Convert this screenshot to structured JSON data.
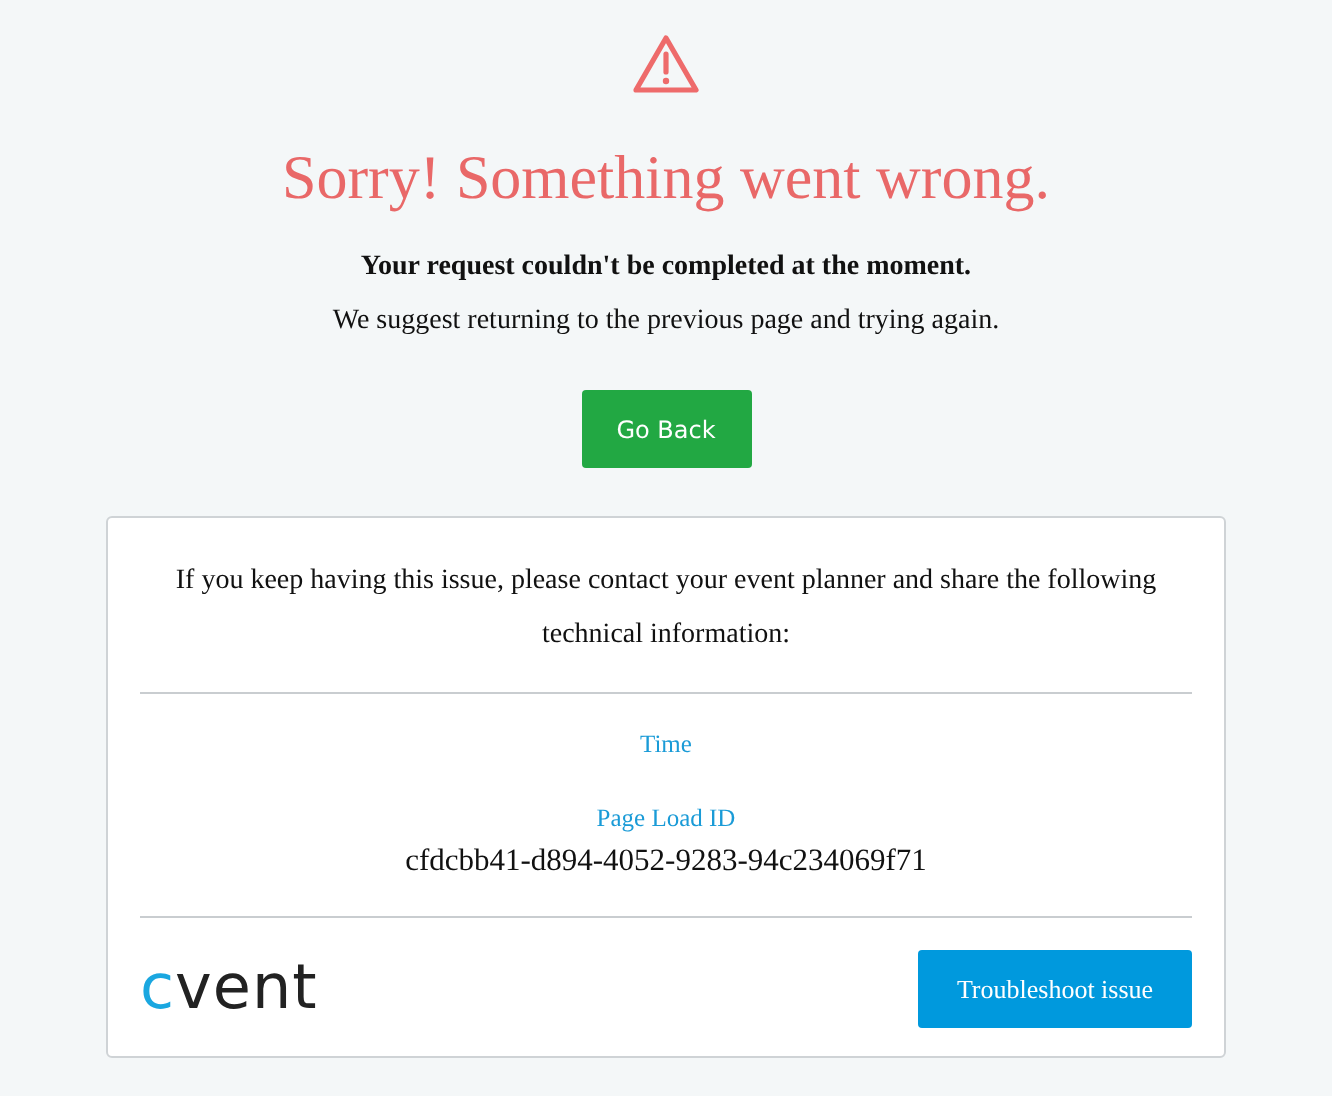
{
  "heading": "Sorry! Something went wrong.",
  "message_bold": "Your request couldn't be completed at the moment.",
  "message": "We suggest returning to the previous page and trying again.",
  "back_button": "Go Back",
  "card": {
    "intro": "If you keep having this issue, please contact your event planner and share the following technical information:",
    "fields": [
      {
        "label": "Time"
      },
      {
        "label": "Page Load ID",
        "value": "cfdcbb41-d894-4052-9283-94c234069f71"
      }
    ],
    "logo": "cvent",
    "troubleshoot_button": "Troubleshoot issue"
  }
}
